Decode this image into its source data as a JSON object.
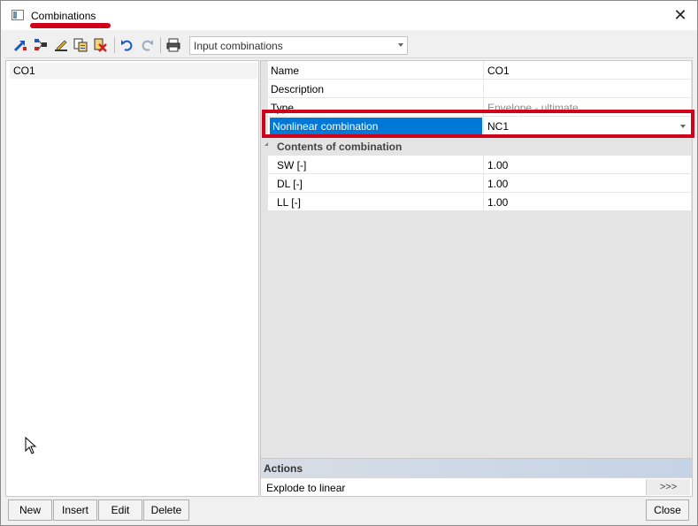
{
  "window": {
    "title": "Combinations",
    "close_icon": "close-icon"
  },
  "toolbar": {
    "icons": [
      "new-combination-icon",
      "split-icon",
      "edit-icon",
      "copy-icon",
      "delete-icon",
      "undo-icon",
      "redo-icon",
      "print-icon"
    ],
    "combo_value": "Input combinations"
  },
  "list": {
    "items": [
      "CO1"
    ]
  },
  "properties": {
    "name_label": "Name",
    "name_value": "CO1",
    "description_label": "Description",
    "description_value": "",
    "type_label": "Type",
    "type_value": "Envelope - ultimate",
    "nonlinear_label": "Nonlinear combination",
    "nonlinear_value": "NC1",
    "contents_header": "Contents of combination",
    "contents": [
      {
        "label": "SW [-]",
        "value": "1.00"
      },
      {
        "label": "DL [-]",
        "value": "1.00"
      },
      {
        "label": "LL [-]",
        "value": "1.00"
      }
    ]
  },
  "actions": {
    "header": "Actions",
    "items": [
      {
        "label": "Explode to linear",
        "button": ">>>"
      }
    ]
  },
  "buttons": {
    "new": "New",
    "insert": "Insert",
    "edit": "Edit",
    "delete": "Delete",
    "close": "Close"
  },
  "colors": {
    "selection": "#0078d7",
    "highlight": "#d0021b"
  }
}
